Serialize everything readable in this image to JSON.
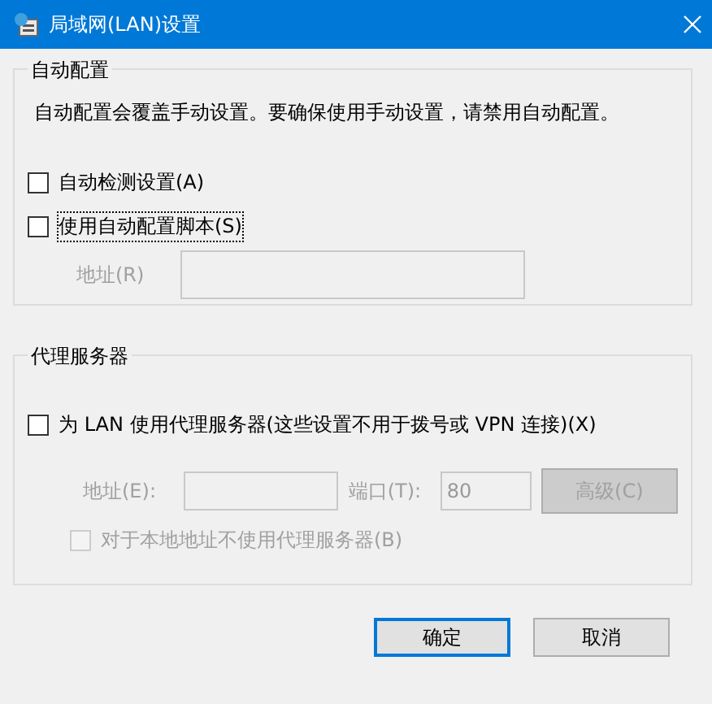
{
  "window": {
    "title": "局域网(LAN)设置"
  },
  "auto_config": {
    "title": "自动配置",
    "description": "自动配置会覆盖手动设置。要确保使用手动设置，请禁用自动配置。",
    "checkboxes": [
      {
        "label": "自动检测设置(A)",
        "checked": false,
        "focused": false
      },
      {
        "label": "使用自动配置脚本(S)",
        "checked": false,
        "focused": true
      }
    ],
    "address": {
      "label": "地址(R)",
      "disabled": true
    }
  },
  "proxy": {
    "title": "代理服务器",
    "checkbox": {
      "label": "为 LAN 使用代理服务器(这些设置不用于拨号或 VPN 连接)(X)",
      "checked": false
    },
    "address": {
      "label": "地址(E):",
      "disabled": true
    },
    "port": {
      "label": "端口(T):",
      "value": "80",
      "disabled": true
    },
    "advanced": {
      "label": "高级(C)",
      "disabled": true
    },
    "bypass": {
      "label": "对于本地地址不使用代理服务器(B)",
      "checked": false,
      "disabled": true
    }
  },
  "buttons": [
    {
      "label": "确定",
      "default": true
    },
    {
      "label": "取消",
      "default": false
    }
  ]
}
